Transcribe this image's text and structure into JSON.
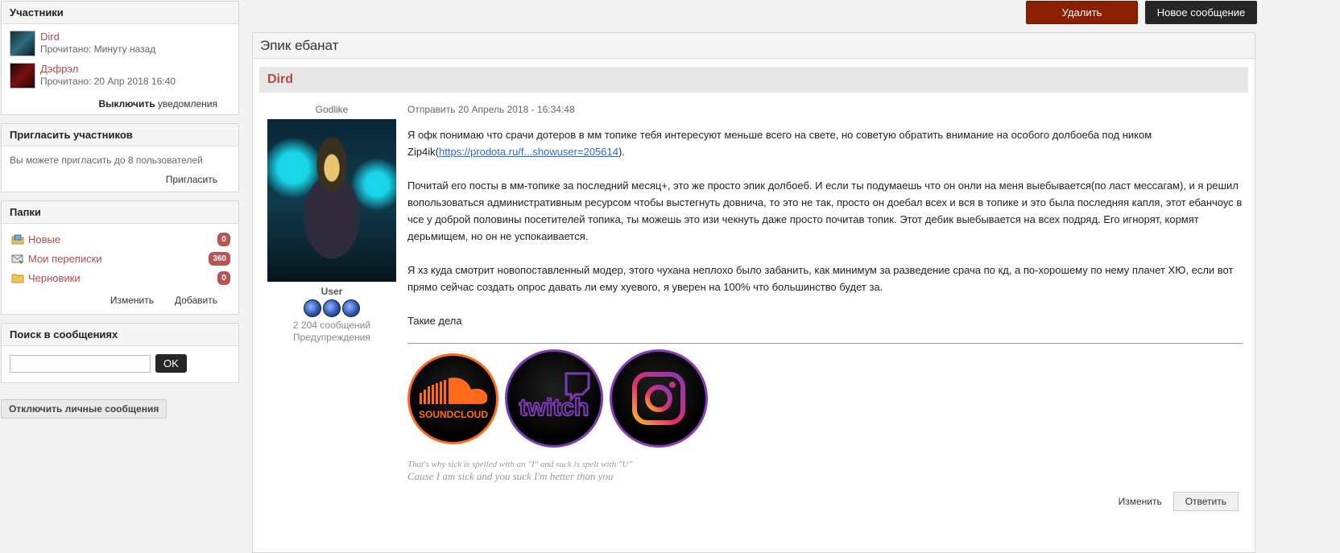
{
  "sidebar": {
    "participants": {
      "title": "Участники",
      "members": [
        {
          "name": "Dird",
          "read": "Прочитано: Минуту назад"
        },
        {
          "name": "Дэфрэл",
          "read": "Прочитано: 20 Апр 2018 16:40"
        }
      ],
      "notif_bold": "Выключить",
      "notif_rest": " уведомления"
    },
    "invite": {
      "title": "Пригласить участников",
      "text": "Вы можете пригласить до 8 пользователей",
      "link": "Пригласить"
    },
    "folders": {
      "title": "Папки",
      "items": [
        {
          "name": "Новые",
          "count": "0",
          "icon": "inbox-folder-icon"
        },
        {
          "name": "Мои переписки",
          "count": "360",
          "icon": "mail-folder-icon"
        },
        {
          "name": "Черновики",
          "count": "0",
          "icon": "folder-icon"
        }
      ],
      "edit": "Изменить",
      "add": "Добавить"
    },
    "search": {
      "title": "Поиск в сообщениях",
      "ok": "OK",
      "value": ""
    },
    "disable_pm": "Отключить личные сообщения"
  },
  "top": {
    "delete": "Удалить",
    "new_message": "Новое сообщение"
  },
  "topic": {
    "title": "Эпик ебанат",
    "post": {
      "author": "Dird",
      "rank": "Godlike",
      "role": "User",
      "posts": "2 204 сообщений",
      "warnings": "Предупреждения",
      "date": "Отправить 20 Апрель 2018 - 16:34:48",
      "p1a": "Я офк понимаю что срачи дотеров в мм топике тебя интересуют меньше всего на свете, но советую обратить внимание на особого долбоеба под ником Zip4ik(",
      "p1link": "https://prodota.ru/f...showuser=205614",
      "p1b": ").",
      "p2": "Почитай его посты в мм-топике за последний месяц+, это же просто эпик долбоеб. И если ты подумаешь что он онли на меня выебывается(по ласт мессагам), и я решил вопользоваться административным ресурсом чтобы выстегнуть довнича, то это не так, просто он доебал всех и вся в топике и это была последняя капля, этот ебанчоус в чсе у доброй половины посетителей топика, ты можешь это изи чекнуть даже просто почитав топик. Этот дебик выебывается на всех подряд. Его игнорят, кормят дерьмищем, но он не успокаивается.",
      "p3": "Я хз куда смотрит новопоставленный модер, этого чухана неплохо было забанить, как минимум за разведение срача по кд, а по-хорошему по нему плачет ХЮ, если вот прямо сейчас создать опрос давать ли ему хуевого, я уверен на 100% что большинство будет за.",
      "p4": "Такие дела",
      "socials": [
        "SOUNDCLOUD",
        "twitch",
        "instagram"
      ],
      "sig1": "That's why sick is spelled with an \"I\" and suck is spelt with \"U\"",
      "sig2": "Cause I am sick and you suck I'm better than you",
      "edit": "Изменить",
      "reply": "Ответить"
    }
  },
  "colors": {
    "accent_red": "#b04a4a",
    "delete_btn": "#8b2000",
    "dark_btn": "#262626",
    "soundcloud": "#ff6b1a",
    "twitch": "#7a3bb5"
  }
}
